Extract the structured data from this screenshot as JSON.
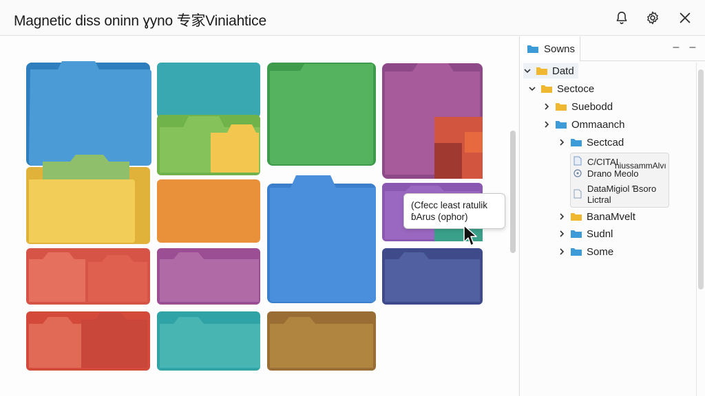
{
  "window": {
    "title": "Magnetic diss oninn ɣyno 专家Viniahtice"
  },
  "titlebar_icons": [
    "bell-icon",
    "gear-icon",
    "close-icon"
  ],
  "tooltip": {
    "line1": "(Cfecc least ratulik",
    "line2": "ɓArus (ophor)"
  },
  "sidebar": {
    "tab_label": "Sowns",
    "controls": [
      "–",
      "–"
    ],
    "tree": [
      {
        "label": "Datd",
        "expanded": true,
        "selected": true
      },
      {
        "label": "Sectoce",
        "expanded": true
      },
      {
        "label": "Suebodd",
        "expanded": false
      },
      {
        "label": "Ommaanch",
        "expanded": false
      },
      {
        "label": "Sectcad",
        "expanded": false
      },
      {
        "label": "BanaMvelt",
        "expanded": false
      },
      {
        "label": "Sudnl",
        "expanded": false
      },
      {
        "label": "Some",
        "expanded": false
      }
    ],
    "popup": {
      "line1": "C/CITAI",
      "line1b": "niussammAlvı",
      "line2": "Drano Meolo",
      "line3": "DataMigiol Ɓsoro",
      "line4": "Lictral"
    }
  },
  "colors": {
    "blue": "#3f94cf",
    "teal": "#3aa9aa",
    "green": "#4bac57",
    "purple": "#a55a98",
    "yellow": "#f0c750",
    "orange": "#e38c3a",
    "coral": "#db5a4b",
    "violet": "#9557a5",
    "navy": "#4a5a98",
    "brown": "#a57a3a",
    "folder_yellow": "#f0b830",
    "folder_blue": "#3d9bd8"
  }
}
